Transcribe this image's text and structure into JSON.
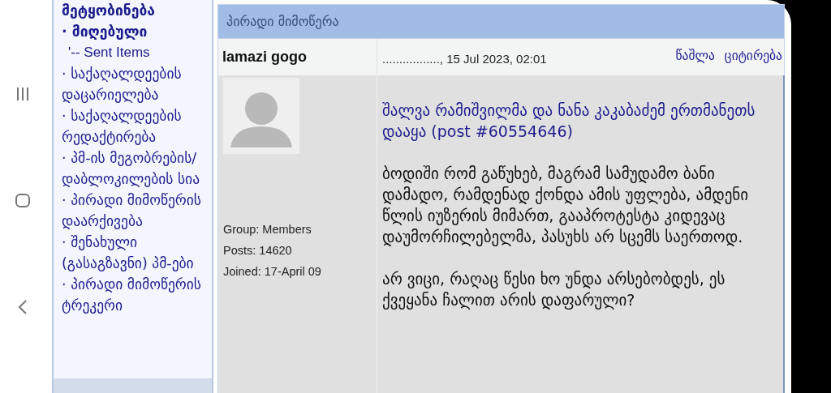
{
  "sidebar": {
    "items": [
      {
        "text": "მეტყობინება",
        "kind": "heading"
      },
      {
        "text": "· მიღებული",
        "kind": "item",
        "selected": true
      },
      {
        "text": "'-- Sent Items",
        "kind": "subitem",
        "selected": false
      },
      {
        "text": "· საქაღალდეების დაცარიელება",
        "kind": "item",
        "selected": false
      },
      {
        "text": "· საქაღალდეების რედაქტირება",
        "kind": "item",
        "selected": false
      },
      {
        "text": "· პმ-ის მეგობრების/ დაბლოკილების სია",
        "kind": "item",
        "selected": false
      },
      {
        "text": "· პირადი მიმოწერის დაარქივება",
        "kind": "item",
        "selected": false
      },
      {
        "text": "· შენახული (გასაგზავნი) პმ-ები",
        "kind": "item",
        "selected": false
      },
      {
        "text": "· პირადი მიმოწერის ტრეკერი",
        "kind": "item",
        "selected": false
      }
    ]
  },
  "panel": {
    "title": "პირადი მიმოწერა"
  },
  "message": {
    "author": "lamazi gogo",
    "date": "................., 15 Jul 2023, 02:01",
    "actions": [
      "წაშლა",
      "ციტირება"
    ],
    "author_info": [
      "Group: Members",
      "Posts: 14620",
      "Joined: 17-April 09"
    ],
    "title_link": "შალვა რამიშვილმა და ნანა კაკაბაძემ ერთმანეთს დააყა (post #60554646)",
    "paragraphs": [
      "ბოდიში რომ გაწუხებ, მაგრამ სამუდამო ბანი დამადო, რამდენად ქონდა ამის უფლება, ამდენი წლის იუზერის მიმართ, გააპროტესტა კიდევაც დაუმორჩილებელმა, პასუხს არ სცემს საერთოდ.",
      "არ ვიცი, რაღაც წესი ხო უნდა არსებობდეს, ეს ქვეყანა ჩალით არის დაფარული?"
    ]
  }
}
